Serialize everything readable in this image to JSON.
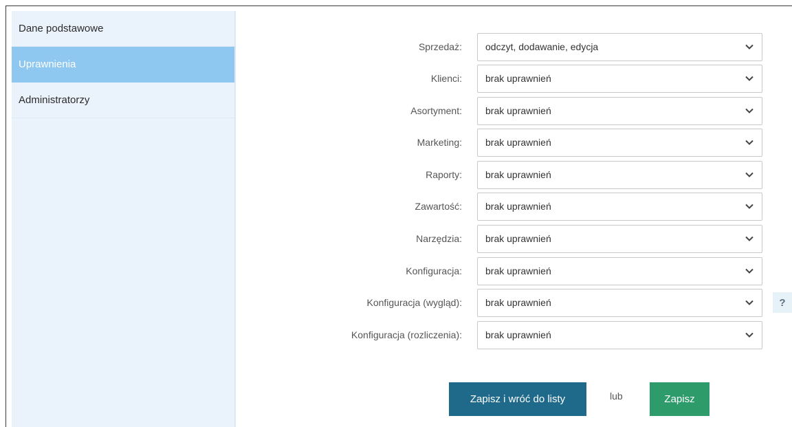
{
  "sidebar": {
    "items": [
      {
        "label": "Dane podstawowe",
        "active": false
      },
      {
        "label": "Uprawnienia",
        "active": true
      },
      {
        "label": "Administratorzy",
        "active": false
      }
    ]
  },
  "permissions": {
    "rows": [
      {
        "label": "Sprzedaż:",
        "value": "odczyt, dodawanie, edycja"
      },
      {
        "label": "Klienci:",
        "value": "brak uprawnień"
      },
      {
        "label": "Asortyment:",
        "value": "brak uprawnień"
      },
      {
        "label": "Marketing:",
        "value": "brak uprawnień"
      },
      {
        "label": "Raporty:",
        "value": "brak uprawnień"
      },
      {
        "label": "Zawartość:",
        "value": "brak uprawnień"
      },
      {
        "label": "Narzędzia:",
        "value": "brak uprawnień"
      },
      {
        "label": "Konfiguracja:",
        "value": "brak uprawnień"
      },
      {
        "label": "Konfiguracja (wygląd):",
        "value": "brak uprawnień"
      },
      {
        "label": "Konfiguracja (rozliczenia):",
        "value": "brak uprawnień"
      }
    ]
  },
  "help": {
    "label": "?"
  },
  "actions": {
    "save_and_back": "Zapisz i wróć do listy",
    "or": "lub",
    "save": "Zapisz"
  },
  "colors": {
    "sidebar_bg": "#eaf3fc",
    "active_item": "#8ec8f0",
    "primary_button": "#1f6a8a",
    "save_button": "#2e9b6a"
  }
}
